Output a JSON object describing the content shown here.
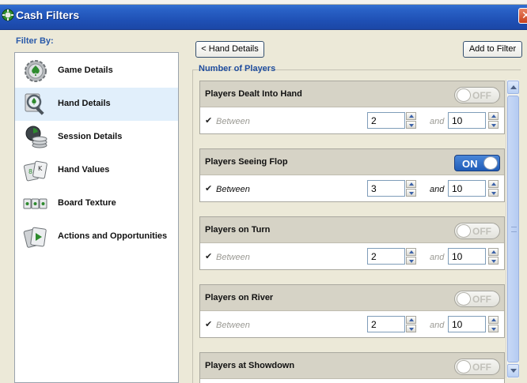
{
  "window": {
    "title": "Cash Filters"
  },
  "sidebar": {
    "heading": "Filter By:",
    "items": [
      {
        "label": "Game Details",
        "icon": "spade-gear-icon",
        "selected": false
      },
      {
        "label": "Hand Details",
        "icon": "magnifier-icon",
        "selected": true
      },
      {
        "label": "Session Details",
        "icon": "clock-chips-icon",
        "selected": false
      },
      {
        "label": "Hand Values",
        "icon": "cards-icon",
        "selected": false
      },
      {
        "label": "Board Texture",
        "icon": "board-cards-icon",
        "selected": false
      },
      {
        "label": "Actions and Opportunities",
        "icon": "play-cards-icon",
        "selected": false
      }
    ]
  },
  "toolbar": {
    "back_label": "< Hand Details",
    "add_label": "Add to Filter"
  },
  "section": {
    "title": "Number of Players"
  },
  "groups": [
    {
      "name": "Players Dealt Into Hand",
      "toggle": "OFF",
      "on": false,
      "row_label": "Between",
      "and_label": "and",
      "min": "2",
      "max": "10"
    },
    {
      "name": "Players Seeing Flop",
      "toggle": "ON",
      "on": true,
      "row_label": "Between",
      "and_label": "and",
      "min": "3",
      "max": "10"
    },
    {
      "name": "Players on Turn",
      "toggle": "OFF",
      "on": false,
      "row_label": "Between",
      "and_label": "and",
      "min": "2",
      "max": "10"
    },
    {
      "name": "Players on River",
      "toggle": "OFF",
      "on": false,
      "row_label": "Between",
      "and_label": "and",
      "min": "2",
      "max": "10"
    },
    {
      "name": "Players at Showdown",
      "toggle": "OFF",
      "on": false
    }
  ],
  "colors": {
    "titlebar": "#1f50b5",
    "accent": "#1f4d9e",
    "toggle_on": "#1f5cb8",
    "selected_row": "#e1effb"
  }
}
